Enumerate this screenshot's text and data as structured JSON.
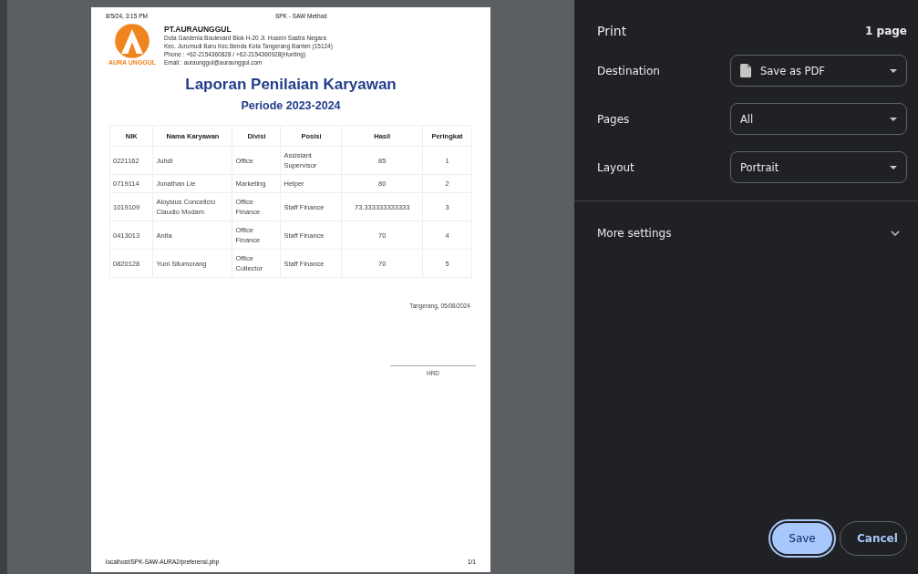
{
  "preview": {
    "header_left": "8/5/24, 3:15 PM",
    "header_center": "SPK - SAW Method",
    "letterhead": {
      "logo_text": "AURA UNGGUL",
      "company": "PT.AURAUNGGUL",
      "lines": [
        "Duta Gardenia Boulevard Blok H-20 Jl. Husein Sastra Negara",
        "Kec. Jurumudi Baru Kec.Benda Kota Tangerang Banten (15124)",
        "Phone : +62-2154360828 / +62-2154360928(Hunting)",
        "Email : auraunggul@auraunggul.com"
      ]
    },
    "title": "Laporan Penilaian Karyawan",
    "subtitle": "Periode 2023-2024",
    "table": {
      "columns": [
        "NIK",
        "Nama Karyawan",
        "Divisi",
        "Posisi",
        "Hasil",
        "Peringkat"
      ],
      "rows": [
        [
          "0221162",
          "Juhdi",
          "Office",
          "Assistant Supervisor",
          "85",
          "1"
        ],
        [
          "0719114",
          "Jonathan Lie",
          "Marketing",
          "Helper",
          "80",
          "2"
        ],
        [
          "1019109",
          "Aloysius Concellcio Claudio Modam",
          "Office Finance",
          "Staff Finance",
          "73.333333333333",
          "3"
        ],
        [
          "0413013",
          "Anita",
          "Office Finance",
          "Staff Finance",
          "70",
          "4"
        ],
        [
          "0820128",
          "Yuni Situmorang",
          "Office Collector",
          "Staff Finance",
          "70",
          "5"
        ]
      ]
    },
    "place_date": "Tangerang, 05/08/2024",
    "signature_label": "HRD",
    "footer_left": "localhost/SPK-SAW-AURA2/preferensi.php",
    "footer_right": "1/1"
  },
  "panel": {
    "title": "Print",
    "page_count": "1 page",
    "settings": [
      {
        "label": "Destination",
        "value": "Save as PDF",
        "kind": "destination"
      },
      {
        "label": "Pages",
        "value": "All",
        "kind": "plain"
      },
      {
        "label": "Layout",
        "value": "Portrait",
        "kind": "plain"
      }
    ],
    "more_settings": {
      "label": "More settings",
      "expanded": false
    },
    "buttons": [
      {
        "label": "Save",
        "kind": "primary"
      },
      {
        "label": "Cancel",
        "kind": "secondary"
      }
    ]
  }
}
